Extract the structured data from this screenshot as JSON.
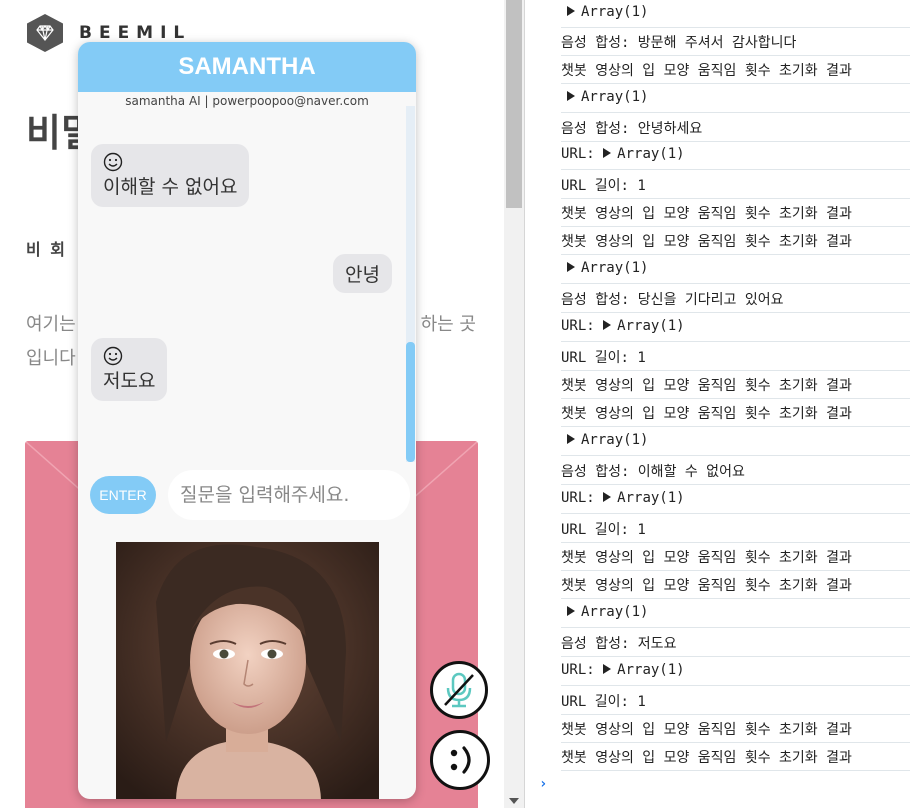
{
  "site": {
    "logo_text": "BEEMIL",
    "heading": "비밀",
    "sub_heading": "비 회",
    "desc_line1_start": "여기는",
    "desc_line1_end": "하는 곳",
    "desc_line2": "입니다"
  },
  "chat": {
    "title": "SAMANTHA",
    "subtitle": "samantha AI | powerpoopoo@naver.com",
    "messages": [
      {
        "from": "bot",
        "text": "이해할 수 없어요"
      },
      {
        "from": "user",
        "text": "안녕"
      },
      {
        "from": "bot",
        "text": "저도요"
      }
    ],
    "enter_label": "ENTER",
    "input_placeholder": "질문을 입력해주세요."
  },
  "console": {
    "lines": [
      {
        "type": "array",
        "text": "Array(1)"
      },
      {
        "type": "text",
        "text": "음성 합성: 방문해 주셔서 감사합니다"
      },
      {
        "type": "text",
        "text": "챗봇 영상의 입 모양 움직임 횟수 초기화 결과"
      },
      {
        "type": "array",
        "text": "Array(1)"
      },
      {
        "type": "text",
        "text": "음성 합성: 안녕하세요"
      },
      {
        "type": "url",
        "text": "URL: ",
        "arr": "Array(1)"
      },
      {
        "type": "text",
        "text": "URL 길이: 1"
      },
      {
        "type": "text",
        "text": "챗봇 영상의 입 모양 움직임 횟수 초기화 결과"
      },
      {
        "type": "text",
        "text": "챗봇 영상의 입 모양 움직임 횟수 초기화 결과"
      },
      {
        "type": "array",
        "text": "Array(1)"
      },
      {
        "type": "text",
        "text": "음성 합성: 당신을 기다리고 있어요"
      },
      {
        "type": "url",
        "text": "URL: ",
        "arr": "Array(1)"
      },
      {
        "type": "text",
        "text": "URL 길이: 1"
      },
      {
        "type": "text",
        "text": "챗봇 영상의 입 모양 움직임 횟수 초기화 결과"
      },
      {
        "type": "text",
        "text": "챗봇 영상의 입 모양 움직임 횟수 초기화 결과"
      },
      {
        "type": "array",
        "text": "Array(1)"
      },
      {
        "type": "text",
        "text": "음성 합성: 이해할 수 없어요"
      },
      {
        "type": "url",
        "text": "URL: ",
        "arr": "Array(1)"
      },
      {
        "type": "text",
        "text": "URL 길이: 1"
      },
      {
        "type": "text",
        "text": "챗봇 영상의 입 모양 움직임 횟수 초기화 결과"
      },
      {
        "type": "text",
        "text": "챗봇 영상의 입 모양 움직임 횟수 초기화 결과"
      },
      {
        "type": "array",
        "text": "Array(1)"
      },
      {
        "type": "text",
        "text": "음성 합성: 저도요"
      },
      {
        "type": "url",
        "text": "URL: ",
        "arr": "Array(1)"
      },
      {
        "type": "text",
        "text": "URL 길이: 1"
      },
      {
        "type": "text",
        "text": "챗봇 영상의 입 모양 움직임 횟수 초기화 결과"
      },
      {
        "type": "text",
        "text": "챗봇 영상의 입 모양 움직임 횟수 초기화 결과"
      }
    ],
    "prompt_symbol": "›"
  },
  "colors": {
    "accent": "#83cbf6",
    "envelope": "#e58295",
    "bubble": "#e6e6e9"
  },
  "icons": [
    "diamond-icon",
    "smile-icon",
    "mic-off-icon",
    "face-icon",
    "disclosure-triangle-icon"
  ]
}
